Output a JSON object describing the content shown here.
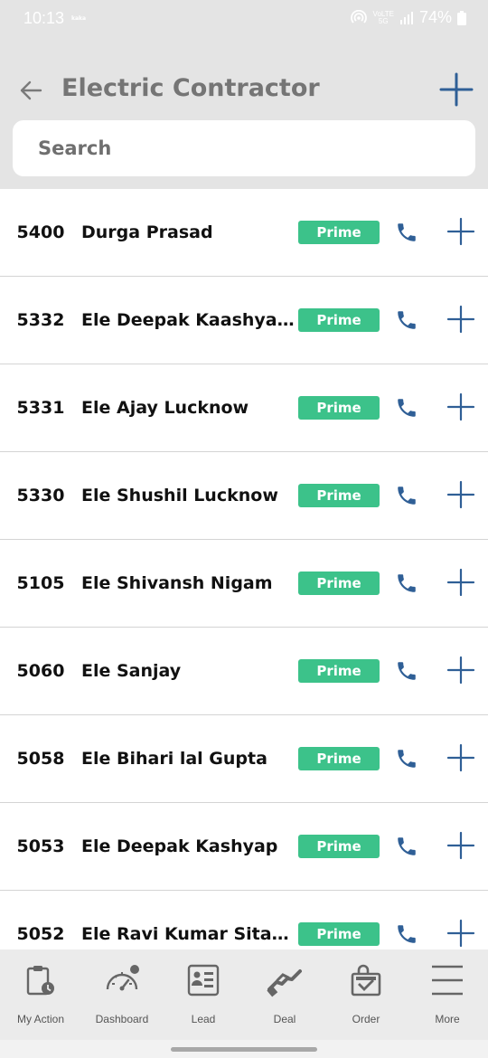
{
  "status_bar": {
    "time": "10:13",
    "mini_label": "kaka",
    "network_line1": "VoLTE",
    "network_line2": "5G",
    "battery": "74%"
  },
  "header": {
    "title": "Electric Contractor",
    "search_placeholder": "Search"
  },
  "contractors": [
    {
      "code": "5400",
      "name": "Durga Prasad",
      "badge": "Prime"
    },
    {
      "code": "5332",
      "name": "Ele Deepak Kaashyap ...",
      "badge": "Prime"
    },
    {
      "code": "5331",
      "name": "Ele Ajay Lucknow",
      "badge": "Prime"
    },
    {
      "code": "5330",
      "name": "Ele Shushil Lucknow",
      "badge": "Prime"
    },
    {
      "code": "5105",
      "name": "Ele Shivansh Nigam",
      "badge": "Prime"
    },
    {
      "code": "5060",
      "name": "Ele Sanjay",
      "badge": "Prime"
    },
    {
      "code": "5058",
      "name": "Ele Bihari lal Gupta",
      "badge": "Prime"
    },
    {
      "code": "5053",
      "name": "Ele Deepak Kashyap",
      "badge": "Prime"
    },
    {
      "code": "5052",
      "name": "Ele Ravi Kumar Sitapur",
      "badge": "Prime"
    }
  ],
  "bottom_nav": [
    {
      "label": "My Action",
      "icon": "clipboard-clock-icon"
    },
    {
      "label": "Dashboard",
      "icon": "speedometer-icon"
    },
    {
      "label": "Lead",
      "icon": "contact-card-icon"
    },
    {
      "label": "Deal",
      "icon": "handshake-icon"
    },
    {
      "label": "Order",
      "icon": "shopping-bag-icon"
    },
    {
      "label": "More",
      "icon": "menu-icon"
    }
  ],
  "colors": {
    "header_bg": "#e4e4e4",
    "badge": "#3cc28a",
    "accent": "#2f5f96"
  }
}
